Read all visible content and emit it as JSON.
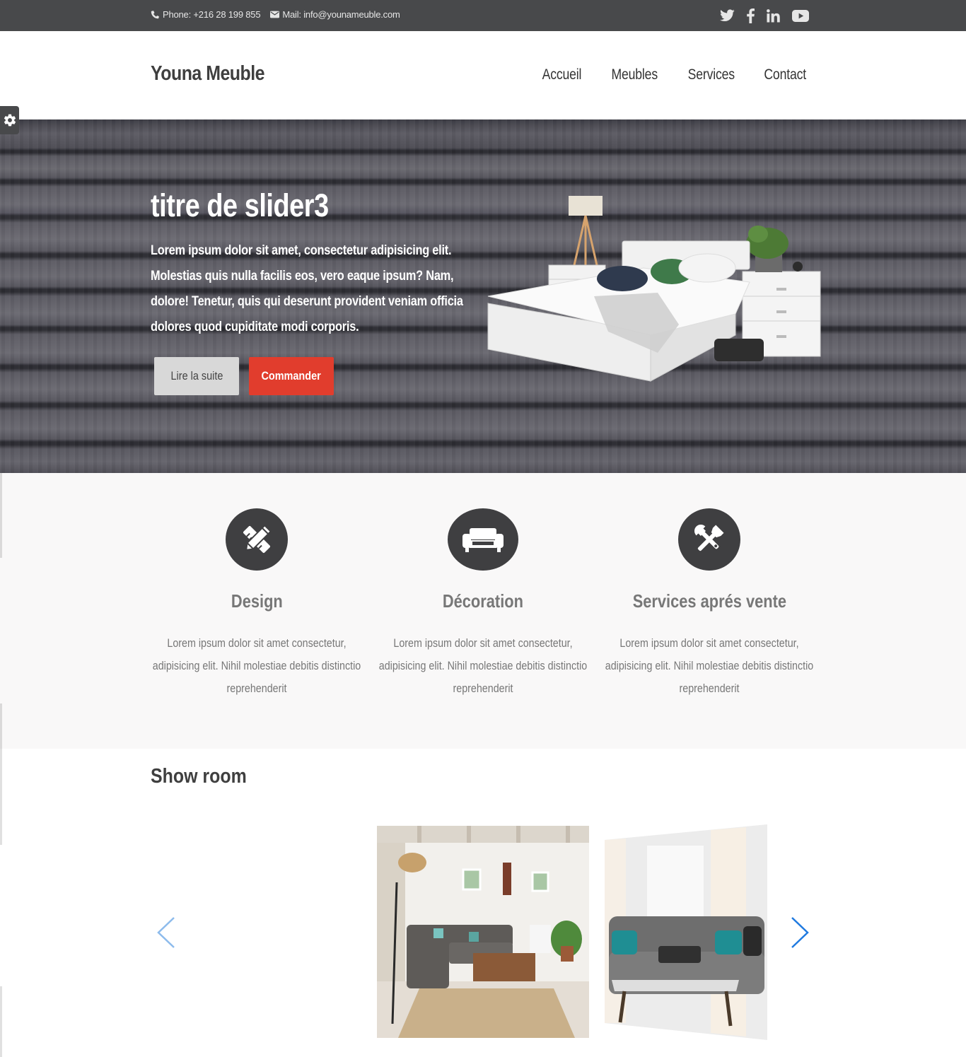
{
  "topbar": {
    "phone": "Phone: +216 28 199 855",
    "mail": "Mail: info@younameuble.com",
    "social_icons": [
      "twitter-icon",
      "facebook-icon",
      "linkedin-icon",
      "youtube-icon"
    ]
  },
  "header": {
    "brand": "Youna Meuble",
    "nav": [
      "Accueil",
      "Meubles",
      "Services",
      "Contact"
    ]
  },
  "hero": {
    "title": "titre de slider3",
    "text": "Lorem ipsum dolor sit amet, consectetur adipisicing elit. Molestias quis nulla facilis eos, vero eaque ipsum? Nam, dolore! Tenetur, quis qui deserunt provident veniam officia dolores quod cupiditate modi corporis.",
    "btn_read": "Lire la suite",
    "btn_order": "Commander"
  },
  "features": [
    {
      "icon": "design-tools-icon",
      "title": "Design",
      "text": "Lorem ipsum dolor sit amet consectetur, adipisicing elit. Nihil molestiae debitis distinctio reprehenderit"
    },
    {
      "icon": "couch-icon",
      "title": "Décoration",
      "text": "Lorem ipsum dolor sit amet consectetur, adipisicing elit. Nihil molestiae debitis distinctio reprehenderit"
    },
    {
      "icon": "tools-icon",
      "title": "Services aprés vente",
      "text": "Lorem ipsum dolor sit amet consectetur, adipisicing elit. Nihil molestiae debitis distinctio reprehenderit"
    }
  ],
  "showroom": {
    "title": "Show room"
  },
  "colors": {
    "topbar": "#48494b",
    "accent_red": "#e13d2d",
    "feature_bg": "#f9f8f8",
    "arrow_blue": "#1f7ae0"
  }
}
